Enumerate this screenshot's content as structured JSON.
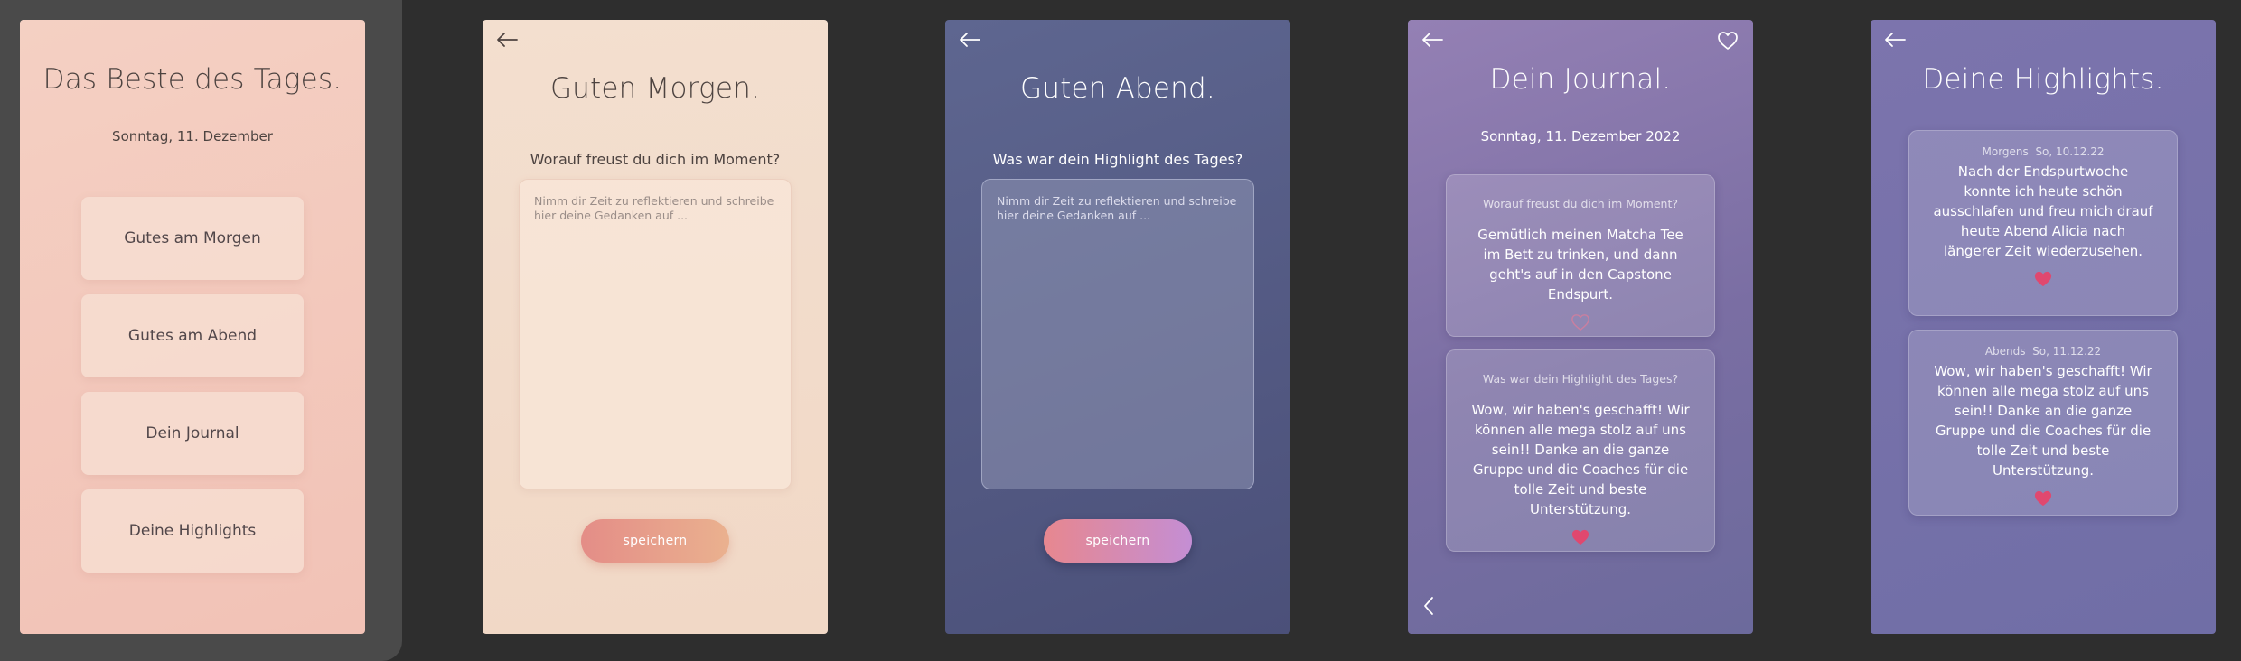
{
  "colors": {
    "background": "#2e2e2e",
    "peach": "#f2c2b6",
    "cream": "#f3dfcf",
    "navy": "#4b5079",
    "purple": "#8b7ab0",
    "heart_pink": "#e0486f",
    "save_peach": "#e48d87",
    "save_violet": "#c48ed4"
  },
  "screen1": {
    "title": "Das Beste des Tages.",
    "date": "Sonntag, 11. Dezember",
    "menu": [
      {
        "label": "Gutes am Morgen"
      },
      {
        "label": "Gutes am Abend"
      },
      {
        "label": "Dein Journal"
      },
      {
        "label": "Deine Highlights"
      }
    ]
  },
  "screen2": {
    "back_icon": "arrow-left-icon",
    "title": "Guten Morgen.",
    "question": "Worauf freust du dich im Moment?",
    "placeholder": "Nimm dir Zeit zu reflektieren und schreibe hier deine Gedanken auf ...",
    "save_label": "speichern"
  },
  "screen3": {
    "back_icon": "arrow-left-icon",
    "title": "Guten Abend.",
    "question": "Was war dein Highlight des Tages?",
    "placeholder": "Nimm dir Zeit zu reflektieren und schreibe hier deine Gedanken auf ...",
    "save_label": "speichern"
  },
  "screen4": {
    "back_icon": "arrow-left-icon",
    "favorite_icon": "heart-outline-icon",
    "title": "Dein Journal.",
    "date": "Sonntag, 11. Dezember 2022",
    "entries": [
      {
        "question": "Worauf freust du dich im Moment?",
        "text": "Gemütlich meinen Matcha Tee im Bett zu trinken, und dann geht's auf in den Capstone Endspurt.",
        "liked": false
      },
      {
        "question": "Was war dein Highlight des Tages?",
        "text": "Wow, wir haben's geschafft! Wir können alle mega stolz auf uns sein!! Danke an die ganze Gruppe und die Coaches für die tolle Zeit und beste Unterstützung.",
        "liked": true
      }
    ],
    "prev_icon": "chevron-left-icon"
  },
  "screen5": {
    "back_icon": "arrow-left-icon",
    "title": "Deine Highlights.",
    "highlights": [
      {
        "label": "Morgens",
        "date": "So, 10.12.22",
        "text": "Nach der Endspurtwoche konnte ich heute schön ausschlafen und freu mich drauf heute Abend Alicia nach längerer Zeit wiederzusehen.",
        "liked": true
      },
      {
        "label": "Abends",
        "date": "So, 11.12.22",
        "text": "Wow, wir haben's geschafft! Wir können alle mega stolz auf uns sein!! Danke an die ganze Gruppe und die Coaches für die tolle Zeit und beste Unterstützung.",
        "liked": true
      }
    ]
  }
}
